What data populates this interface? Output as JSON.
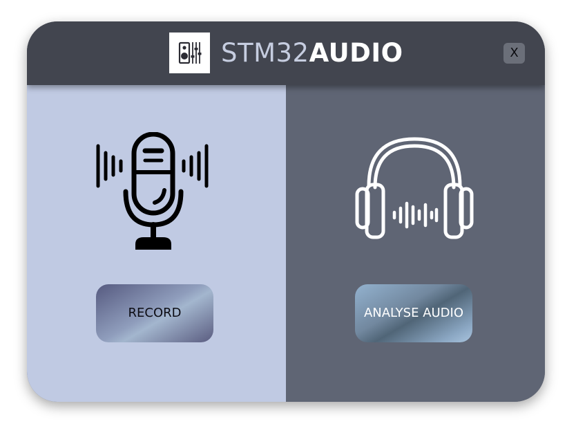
{
  "header": {
    "title_part1": "STM32",
    "title_part2": "AUDIO",
    "logo_icon": "mixer-speaker-icon",
    "close_label": "X"
  },
  "left_panel": {
    "icon": "microphone-icon",
    "button_label": "RECORD"
  },
  "right_panel": {
    "icon": "headphones-icon",
    "button_label": "ANALYSE AUDIO"
  },
  "colors": {
    "header_bg": "#42454f",
    "left_bg": "#c0cae3",
    "right_bg": "#5f6574",
    "title_light": "#c6cde0",
    "title_bold": "#ffffff"
  }
}
